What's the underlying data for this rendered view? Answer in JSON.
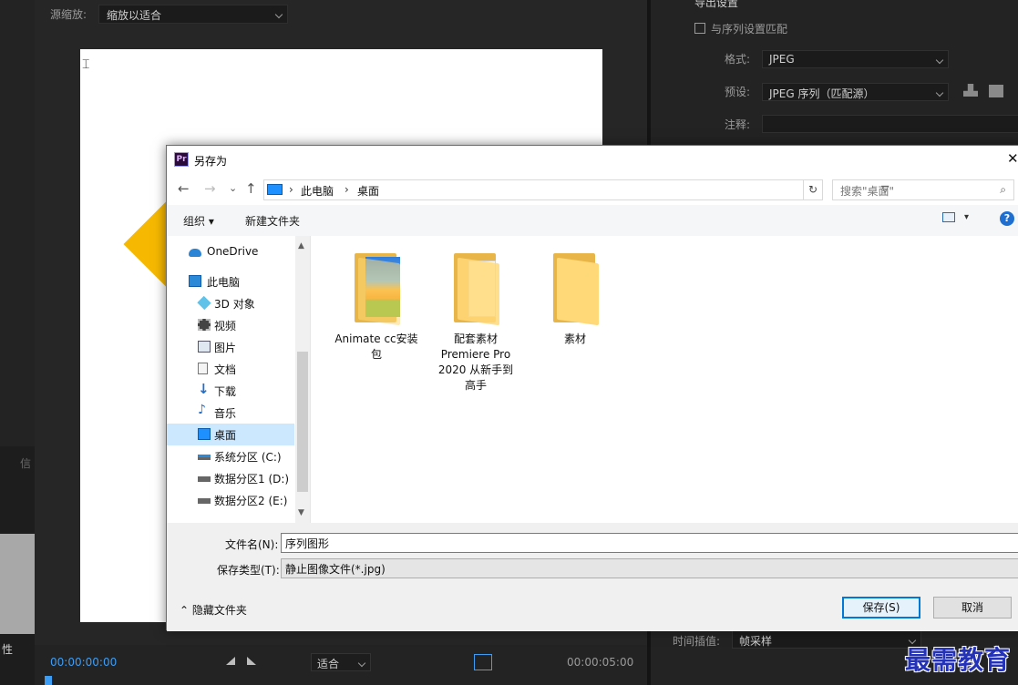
{
  "premiere": {
    "source_scale_label": "源缩放:",
    "source_scale_value": "缩放以适合",
    "left_label": "性",
    "left_tab_label": "信",
    "timecode_in": "00:00:00:00",
    "timecode_out": "00:00:05:00",
    "fit_value": "适合",
    "export_settings_header": "导出设置",
    "match_sequence_label": "与序列设置匹配",
    "format_label": "格式:",
    "format_value": "JPEG",
    "preset_label": "预设:",
    "preset_value": "JPEG 序列（匹配源）",
    "notes_label": "注释:",
    "interp_label": "时间插值:",
    "interp_value": "帧采样"
  },
  "dialog": {
    "title": "另存为",
    "app_icon_text": "Pr",
    "close_glyph": "✕",
    "nav": {
      "back": "←",
      "forward": "→",
      "recent": "⌄",
      "up": "↑"
    },
    "breadcrumb": [
      "此电脑",
      "桌面"
    ],
    "breadcrumb_sep": "›",
    "refresh_glyph": "↻",
    "search_placeholder": "搜索\"桌面\"",
    "search_glyph": "⌕",
    "toolbar": {
      "organize": "组织 ▾",
      "new_folder": "新建文件夹",
      "help": "?",
      "view_drop": "▾"
    },
    "nav_pane": [
      {
        "label": "OneDrive",
        "icon": "cloud-icon"
      },
      {
        "label": "此电脑",
        "icon": "computer-icon"
      },
      {
        "label": "3D 对象",
        "icon": "cube-icon"
      },
      {
        "label": "视频",
        "icon": "film-icon"
      },
      {
        "label": "图片",
        "icon": "picture-icon"
      },
      {
        "label": "文档",
        "icon": "document-icon"
      },
      {
        "label": "下载",
        "icon": "download-icon"
      },
      {
        "label": "音乐",
        "icon": "music-icon"
      },
      {
        "label": "桌面",
        "icon": "desktop-icon",
        "selected": true
      },
      {
        "label": "系统分区 (C:)",
        "icon": "drive-icon"
      },
      {
        "label": "数据分区1 (D:)",
        "icon": "drive-icon"
      },
      {
        "label": "数据分区2 (E:)",
        "icon": "drive-icon"
      }
    ],
    "files": [
      {
        "label": "Animate cc安装包",
        "kind": "archive-folder"
      },
      {
        "label": "配套素材 Premiere Pro 2020 从新手到高手",
        "kind": "paper-folder"
      },
      {
        "label": "素材",
        "kind": "folder"
      }
    ],
    "filename_label": "文件名(N):",
    "filename_value": "序列图形",
    "filetype_label": "保存类型(T):",
    "filetype_value": "静止图像文件(*.jpg)",
    "hide_folders": "隐藏文件夹",
    "save_button": "保存(S)",
    "cancel_button": "取消"
  },
  "watermark": "最需教育"
}
